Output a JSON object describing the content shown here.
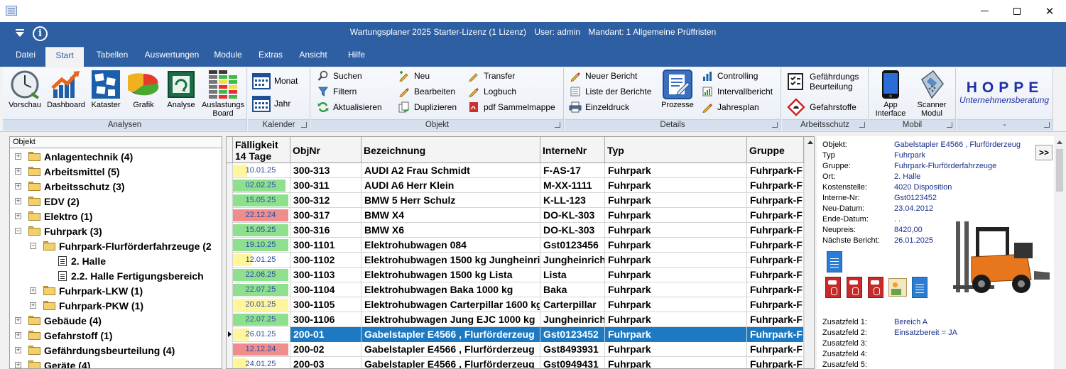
{
  "window": {
    "title_parts": [
      "Wartungsplaner 2025 Starter-Lizenz (1 Lizenz)",
      "User: admin",
      "Mandant: 1 Allgemeine Prüffristen"
    ],
    "info_glyph": "i"
  },
  "menu_tabs": [
    {
      "label": "Datei"
    },
    {
      "label": "Start"
    },
    {
      "label": "Tabellen"
    },
    {
      "label": "Auswertungen"
    },
    {
      "label": "Module"
    },
    {
      "label": "Extras"
    },
    {
      "label": "Ansicht"
    },
    {
      "label": "Hilfe"
    }
  ],
  "ribbon": {
    "analysen": {
      "caption": "Analysen",
      "buttons": [
        "Vorschau",
        "Dashboard",
        "Kataster",
        "Grafik",
        "Analyse",
        "Auslastungs Board"
      ]
    },
    "kalender": {
      "caption": "Kalender",
      "buttons": [
        "Monat",
        "Jahr"
      ]
    },
    "objekt": {
      "caption": "Objekt",
      "buttons": [
        "Suchen",
        "Filtern",
        "Aktualisieren",
        "Neu",
        "Bearbeiten",
        "Duplizieren",
        "Transfer",
        "Logbuch",
        "pdf Sammelmappe"
      ]
    },
    "details": {
      "caption": "Details",
      "buttons": [
        "Neuer Bericht",
        "Liste der Berichte",
        "Einzeldruck",
        "Prozesse",
        "Controlling",
        "Intervallbericht",
        "Jahresplan"
      ]
    },
    "arbeitsschutz": {
      "caption": "Arbeitsschutz",
      "buttons": [
        "Gefährdungs Beurteilung",
        "Gefahrstoffe"
      ]
    },
    "mobil": {
      "caption": "Mobil",
      "buttons": [
        "App Interface",
        "Scanner Modul"
      ]
    },
    "logo": {
      "caption": "-",
      "brand": "HOPPE",
      "sub": "Unternehmensberatung"
    }
  },
  "tree": {
    "header": "Objekt",
    "items": [
      {
        "label": "Anlagentechnik  (4)",
        "type": "folder",
        "expander": "+"
      },
      {
        "label": "Arbeitsmittel  (5)",
        "type": "folder",
        "expander": "+"
      },
      {
        "label": "Arbeitsschutz  (3)",
        "type": "folder",
        "expander": "+"
      },
      {
        "label": "EDV  (2)",
        "type": "folder",
        "expander": "+"
      },
      {
        "label": "Elektro  (1)",
        "type": "folder",
        "expander": "+"
      },
      {
        "label": "Fuhrpark  (3)",
        "type": "folder-open",
        "expander": "−"
      },
      {
        "label": "Fuhrpark-Flurförderfahrzeuge  (2",
        "type": "folder-open",
        "expander": "−"
      },
      {
        "label": "2. Halle",
        "type": "doc",
        "expander": ""
      },
      {
        "label": "2.2. Halle Fertigungsbereich",
        "type": "doc",
        "expander": ""
      },
      {
        "label": "Fuhrpark-LKW  (1)",
        "type": "folder",
        "expander": "+"
      },
      {
        "label": "Fuhrpark-PKW  (1)",
        "type": "folder",
        "expander": "+"
      },
      {
        "label": "Gebäude  (4)",
        "type": "folder",
        "expander": "+"
      },
      {
        "label": "Gefahrstoff  (1)",
        "type": "folder",
        "expander": "+"
      },
      {
        "label": "Gefährdungsbeurteilung  (4)",
        "type": "folder",
        "expander": "+"
      },
      {
        "label": "Geräte  (4)",
        "type": "folder",
        "expander": "+"
      }
    ]
  },
  "grid": {
    "columns": {
      "due_line1": "Fälligkeit",
      "due_line2": "14 Tage",
      "objnr": "ObjNr",
      "bezeichnung": "Bezeichnung",
      "internenr": "InterneNr",
      "typ": "Typ",
      "gruppe": "Gruppe"
    },
    "status_colors": {
      "ok": "#8ee08e",
      "soon": "#fff59d",
      "overdue": "#f08c8c"
    },
    "rows": [
      {
        "due": "10.01.25",
        "status": "soon",
        "fill": 0.25,
        "objnr": "300-313",
        "bezeichnung": "AUDI A2 Frau Schmidt",
        "internenr": "F-AS-17",
        "typ": "Fuhrpark",
        "gruppe": "Fuhrpark-F"
      },
      {
        "due": "02.02.25",
        "status": "ok",
        "fill": 0.95,
        "objnr": "300-311",
        "bezeichnung": "AUDI A6 Herr Klein",
        "internenr": "M-XX-1111",
        "typ": "Fuhrpark",
        "gruppe": "Fuhrpark-F"
      },
      {
        "due": "15.05.25",
        "status": "ok",
        "fill": 1.0,
        "objnr": "300-312",
        "bezeichnung": "BMW 5 Herr Schulz",
        "internenr": "K-LL-123",
        "typ": "Fuhrpark",
        "gruppe": "Fuhrpark-F"
      },
      {
        "due": "22.12.24",
        "status": "overdue",
        "fill": 1.0,
        "objnr": "300-317",
        "bezeichnung": "BMW X4",
        "internenr": "DO-KL-303",
        "typ": "Fuhrpark",
        "gruppe": "Fuhrpark-F"
      },
      {
        "due": "15.05.25",
        "status": "ok",
        "fill": 1.0,
        "objnr": "300-316",
        "bezeichnung": "BMW X6",
        "internenr": "DO-KL-303",
        "typ": "Fuhrpark",
        "gruppe": "Fuhrpark-F"
      },
      {
        "due": "19.10.25",
        "status": "ok",
        "fill": 1.0,
        "objnr": "300-1101",
        "bezeichnung": "Elektrohubwagen 084",
        "internenr": "Gst0123456",
        "typ": "Fuhrpark",
        "gruppe": "Fuhrpark-F"
      },
      {
        "due": "12.01.25",
        "status": "soon",
        "fill": 0.35,
        "objnr": "300-1102",
        "bezeichnung": "Elektrohubwagen 1500 kg  Jungheinrich",
        "internenr": "Jungheinrich",
        "typ": "Fuhrpark",
        "gruppe": "Fuhrpark-F"
      },
      {
        "due": "22.06.25",
        "status": "ok",
        "fill": 1.0,
        "objnr": "300-1103",
        "bezeichnung": "Elektrohubwagen 1500 kg Lista",
        "internenr": "Lista",
        "typ": "Fuhrpark",
        "gruppe": "Fuhrpark-F"
      },
      {
        "due": "22.07.25",
        "status": "ok",
        "fill": 1.0,
        "objnr": "300-1104",
        "bezeichnung": "Elektrohubwagen Baka 1000 kg",
        "internenr": "Baka",
        "typ": "Fuhrpark",
        "gruppe": "Fuhrpark-F"
      },
      {
        "due": "20.01.25",
        "status": "soon",
        "fill": 1.0,
        "objnr": "300-1105",
        "bezeichnung": "Elektrohubwagen Carterpillar 1600 kg",
        "internenr": "Carterpillar",
        "typ": "Fuhrpark",
        "gruppe": "Fuhrpark-F"
      },
      {
        "due": "22.07.25",
        "status": "ok",
        "fill": 1.0,
        "objnr": "300-1106",
        "bezeichnung": "Elektrohubwagen Jung EJC 1000 kg",
        "internenr": "Jungheinrich",
        "typ": "Fuhrpark",
        "gruppe": "Fuhrpark-F"
      },
      {
        "due": "26.01.25",
        "status": "soon",
        "fill": 0.3,
        "objnr": "200-01",
        "bezeichnung": "Gabelstapler E4566 , Flurförderzeug",
        "internenr": "Gst0123452",
        "typ": "Fuhrpark",
        "gruppe": "Fuhrpark-F",
        "selected": true
      },
      {
        "due": "12.12.24",
        "status": "overdue",
        "fill": 1.0,
        "objnr": "200-02",
        "bezeichnung": "Gabelstapler E4566 , Flurförderzeug",
        "internenr": "Gst8493931",
        "typ": "Fuhrpark",
        "gruppe": "Fuhrpark-F"
      },
      {
        "due": "24.01.25",
        "status": "soon",
        "fill": 0.25,
        "objnr": "200-03",
        "bezeichnung": "Gabelstapler E4566 , Flurförderzeug",
        "internenr": "Gst0949431",
        "typ": "Fuhrpark",
        "gruppe": "Fuhrpark-F"
      }
    ]
  },
  "details": {
    "more_label": ">>",
    "fields": [
      {
        "k": "Objekt:",
        "v": "Gabelstapler E4566 , Flurförderzeug"
      },
      {
        "k": "Typ",
        "v": "Fuhrpark"
      },
      {
        "k": "Gruppe:",
        "v": "Fuhrpark-Flurförderfahrzeuge"
      },
      {
        "k": "Ort:",
        "v": "2. Halle"
      },
      {
        "k": "Kostenstelle:",
        "v": "4020 Disposition"
      },
      {
        "k": "Interne-Nr:",
        "v": "Gst0123452"
      },
      {
        "k": "Neu-Datum:",
        "v": "23.04.2012"
      },
      {
        "k": "Ende-Datum:",
        "v": " .  ."
      },
      {
        "k": "Neupreis:",
        "v": "8420,00"
      },
      {
        "k": "Nächste Bericht:",
        "v": "26.01.2025"
      }
    ],
    "extra_fields": [
      {
        "k": "Zusatzfeld 1:",
        "v": "Bereich A"
      },
      {
        "k": "Zusatzfeld 2:",
        "v": "Einsatzbereit = JA"
      },
      {
        "k": "Zusatzfeld 3:",
        "v": ""
      },
      {
        "k": "Zusatzfeld 4:",
        "v": ""
      },
      {
        "k": "Zusatzfeld 5:",
        "v": ""
      }
    ]
  }
}
